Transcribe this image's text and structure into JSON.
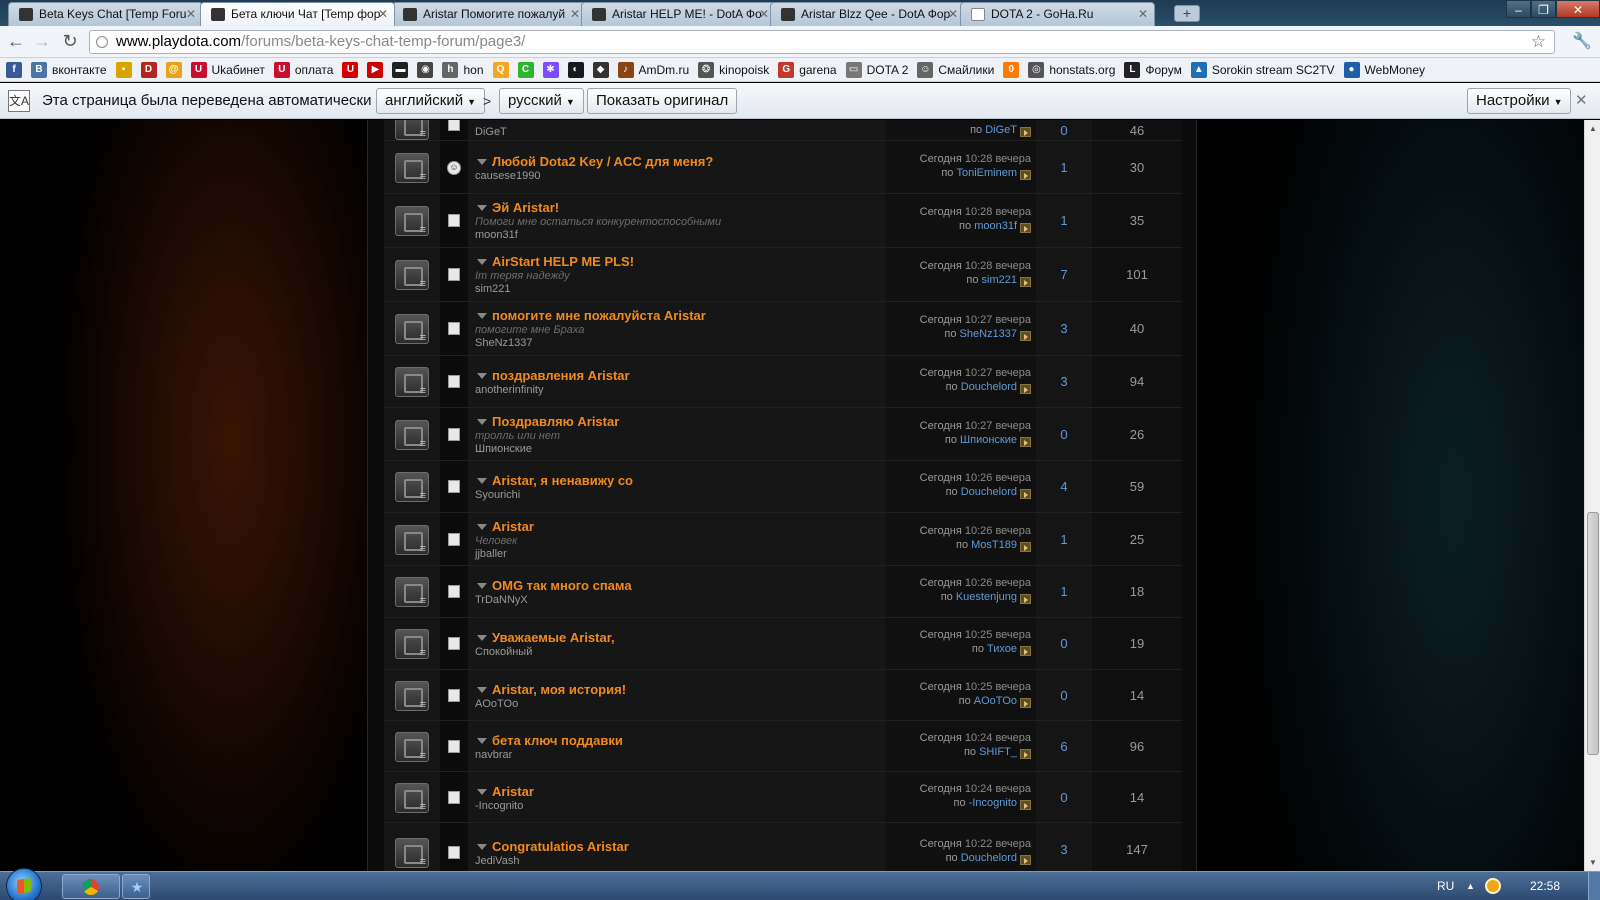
{
  "browser": {
    "tabs": [
      {
        "label": "Beta Keys Chat [Temp Foru",
        "icon": "pd"
      },
      {
        "label": "Бета ключи Чат [Temp фор",
        "icon": "pd"
      },
      {
        "label": "Aristar Помогите пожалуй",
        "icon": "pd"
      },
      {
        "label": "Aristar HELP ME! - DotA Фо",
        "icon": "pd"
      },
      {
        "label": "Aristar Blzz Qee - DotA Фор",
        "icon": "pd"
      },
      {
        "label": "DOTA 2 - GoHa.Ru",
        "icon": "page"
      }
    ],
    "active_tab": 1,
    "url_domain": "www.playdota.com",
    "url_path": "/forums/beta-keys-chat-temp-forum/page3/"
  },
  "bookmarks": [
    {
      "label": "",
      "icon": "facebook-icon",
      "color": "#3b5998",
      "glyph": "f"
    },
    {
      "label": "вконтакте",
      "icon": "vk-icon",
      "color": "#4a76a8",
      "glyph": "В"
    },
    {
      "label": "",
      "icon": "apps-icon",
      "color": "#d9a400",
      "glyph": "▪"
    },
    {
      "label": "",
      "icon": "dota-icon",
      "color": "#b3261e",
      "glyph": "D"
    },
    {
      "label": "",
      "icon": "at-icon",
      "color": "#e8a317",
      "glyph": "@"
    },
    {
      "label": "Ukабинет",
      "icon": "ucabinet-icon",
      "color": "#c8102e",
      "glyph": "U"
    },
    {
      "label": "оплата",
      "icon": "payment-icon",
      "color": "#c8102e",
      "glyph": "U"
    },
    {
      "label": "",
      "icon": "ukr-icon",
      "color": "#d40000",
      "glyph": "U"
    },
    {
      "label": "",
      "icon": "youtube-icon",
      "color": "#cc0000",
      "glyph": "▶"
    },
    {
      "label": "",
      "icon": "game-icon",
      "color": "#222",
      "glyph": "▬"
    },
    {
      "label": "",
      "icon": "hon-logo-icon",
      "color": "#444",
      "glyph": "◉"
    },
    {
      "label": "hon",
      "icon": "hon-icon",
      "color": "#666",
      "glyph": "h"
    },
    {
      "label": "",
      "icon": "q-icon",
      "color": "#f5a623",
      "glyph": "Q"
    },
    {
      "label": "",
      "icon": "c-icon",
      "color": "#2db52d",
      "glyph": "C"
    },
    {
      "label": "",
      "icon": "pinwheel-icon",
      "color": "#7c4dff",
      "glyph": "✱"
    },
    {
      "label": "",
      "icon": "steam-icon",
      "color": "#171a21",
      "glyph": "◐"
    },
    {
      "label": "",
      "icon": "shield-icon",
      "color": "#333",
      "glyph": "◆"
    },
    {
      "label": "AmDm.ru",
      "icon": "guitar-icon",
      "color": "#8b4513",
      "glyph": "♪"
    },
    {
      "label": "kinopoisk",
      "icon": "film-icon",
      "color": "#555",
      "glyph": "❂"
    },
    {
      "label": "garena",
      "icon": "garena-icon",
      "color": "#c0392b",
      "glyph": "G"
    },
    {
      "label": "DOTA 2",
      "icon": "page-icon",
      "color": "#777",
      "glyph": "▭"
    },
    {
      "label": "Смайлики",
      "icon": "smiley-icon",
      "color": "#666",
      "glyph": "☺"
    },
    {
      "label": "",
      "icon": "orange-icon",
      "color": "#ff7a00",
      "glyph": "0"
    },
    {
      "label": "honstats.org",
      "icon": "globe-icon",
      "color": "#555",
      "glyph": "◎"
    },
    {
      "label": "Форум",
      "icon": "forum-icon",
      "color": "#222",
      "glyph": "L"
    },
    {
      "label": "Sorokin stream SC2TV",
      "icon": "sc2tv-icon",
      "color": "#1e6fb8",
      "glyph": "▲"
    },
    {
      "label": "WebMoney",
      "icon": "webmoney-icon",
      "color": "#1d5fa8",
      "glyph": "●"
    }
  ],
  "translate": {
    "message": "Эта страница была переведена автоматически",
    "from_lang": "английский",
    "arrow": ">",
    "to_lang": "русский",
    "show_original": "Показать оригинал",
    "settings": "Настройки"
  },
  "threads": [
    {
      "title": "",
      "subtitle": "",
      "author": "DiGeT",
      "day": "",
      "time": "",
      "by_prefix": "по",
      "last_user": "DiGeT",
      "replies": "0",
      "views": "46",
      "icon": "page",
      "partial": "top"
    },
    {
      "title": "Любой Dota2 Key / ACC для меня?",
      "subtitle": "",
      "author": "causese1990",
      "day": "Сегодня",
      "time": "10:28 вечера",
      "by_prefix": "по",
      "last_user": "ToniEminem",
      "replies": "1",
      "views": "30",
      "icon": "smile"
    },
    {
      "title": "Эй Aristar!",
      "subtitle": "Помоги мне остаться конкурентоспособными",
      "author": "moon31f",
      "day": "Сегодня",
      "time": "10:28 вечера",
      "by_prefix": "по",
      "last_user": "moon31f",
      "replies": "1",
      "views": "35",
      "icon": "page"
    },
    {
      "title": "AirStart HELP ME PLS!",
      "subtitle": "Im теряя надежду",
      "author": "sim221",
      "day": "Сегодня",
      "time": "10:28 вечера",
      "by_prefix": "по",
      "last_user": "sim221",
      "replies": "7",
      "views": "101",
      "icon": "page"
    },
    {
      "title": "помогите мне пожалуйста Aristar",
      "subtitle": "помогите мне Браха",
      "author": "SheNz1337",
      "day": "Сегодня",
      "time": "10:27 вечера",
      "by_prefix": "по",
      "last_user": "SheNz1337",
      "replies": "3",
      "views": "40",
      "icon": "page"
    },
    {
      "title": "поздравления Aristar",
      "subtitle": "",
      "author": "anotherinfinity",
      "day": "Сегодня",
      "time": "10:27 вечера",
      "by_prefix": "по",
      "last_user": "Douchelord",
      "replies": "3",
      "views": "94",
      "icon": "page"
    },
    {
      "title": "Поздравляю Aristar",
      "subtitle": "тролль или нет",
      "author": "Шпионские",
      "day": "Сегодня",
      "time": "10:27 вечера",
      "by_prefix": "по",
      "last_user": "Шпионские",
      "replies": "0",
      "views": "26",
      "icon": "page"
    },
    {
      "title": "Aristar, я ненавижу со",
      "subtitle": "",
      "author": "Syourichi",
      "day": "Сегодня",
      "time": "10:26 вечера",
      "by_prefix": "по",
      "last_user": "Douchelord",
      "replies": "4",
      "views": "59",
      "icon": "page"
    },
    {
      "title": "Aristar",
      "subtitle": "Человек",
      "author": "jjballer",
      "day": "Сегодня",
      "time": "10:26 вечера",
      "by_prefix": "по",
      "last_user": "MosT189",
      "replies": "1",
      "views": "25",
      "icon": "page"
    },
    {
      "title": "OMG так много спама",
      "subtitle": "",
      "author": "TrDaNNyX",
      "day": "Сегодня",
      "time": "10:26 вечера",
      "by_prefix": "по",
      "last_user": "Kuestenjung",
      "replies": "1",
      "views": "18",
      "icon": "page"
    },
    {
      "title": "Уважаемые Aristar,",
      "subtitle": "",
      "author": "Спокойный",
      "day": "Сегодня",
      "time": "10:25 вечера",
      "by_prefix": "по",
      "last_user": "Тихое",
      "replies": "0",
      "views": "19",
      "icon": "page"
    },
    {
      "title": "Aristar, моя история!",
      "subtitle": "",
      "author": "AOoTOo",
      "day": "Сегодня",
      "time": "10:25 вечера",
      "by_prefix": "по",
      "last_user": "AOoTOo",
      "replies": "0",
      "views": "14",
      "icon": "page"
    },
    {
      "title": "бета ключ поддавки",
      "subtitle": "",
      "author": "navbrar",
      "day": "Сегодня",
      "time": "10:24 вечера",
      "by_prefix": "по",
      "last_user": "SHIFT_",
      "replies": "6",
      "views": "96",
      "icon": "page"
    },
    {
      "title": "Aristar",
      "subtitle": "",
      "author": "-Incognito",
      "day": "Сегодня",
      "time": "10:24 вечера",
      "by_prefix": "по",
      "last_user": "-Incognito",
      "replies": "0",
      "views": "14",
      "icon": "page"
    },
    {
      "title": "Congratulatios Aristar",
      "subtitle": "",
      "author": "JediVash",
      "day": "Сегодня",
      "time": "10:22 вечера",
      "by_prefix": "по",
      "last_user": "Douchelord",
      "replies": "3",
      "views": "147",
      "icon": "page"
    }
  ],
  "taskbar": {
    "lang": "RU",
    "clock": "22:58",
    "items": [
      {
        "icon": "chrome-icon"
      },
      {
        "icon": "star-app-icon"
      }
    ]
  }
}
